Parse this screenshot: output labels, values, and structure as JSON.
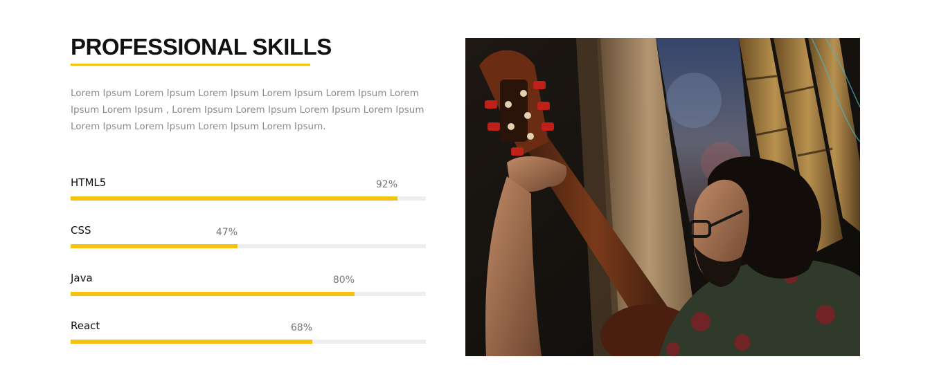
{
  "section": {
    "title": "PROFESSIONAL SKILLS",
    "description": "Lorem Ipsum Lorem Ipsum Lorem Ipsum Lorem Ipsum Lorem Ipsum Lorem Ipsum Lorem Ipsum , Lorem Ipsum Lorem Ipsum Lorem Ipsum Lorem Ipsum Lorem Ipsum Lorem Ipsum Lorem Ipsum Lorem Ipsum."
  },
  "skills": [
    {
      "name": "HTML5",
      "percent_label": "92%",
      "level": 0.92
    },
    {
      "name": "CSS",
      "percent_label": "47%",
      "level": 0.47
    },
    {
      "name": "Java",
      "percent_label": "80%",
      "level": 0.8
    },
    {
      "name": "React",
      "percent_label": "68%",
      "level": 0.68
    }
  ],
  "colors": {
    "accent": "#f7c312",
    "track": "#eeeeee",
    "text": "#111111",
    "muted": "#8a8a8a"
  },
  "photo": {
    "subject": "guitar-player-photo"
  }
}
